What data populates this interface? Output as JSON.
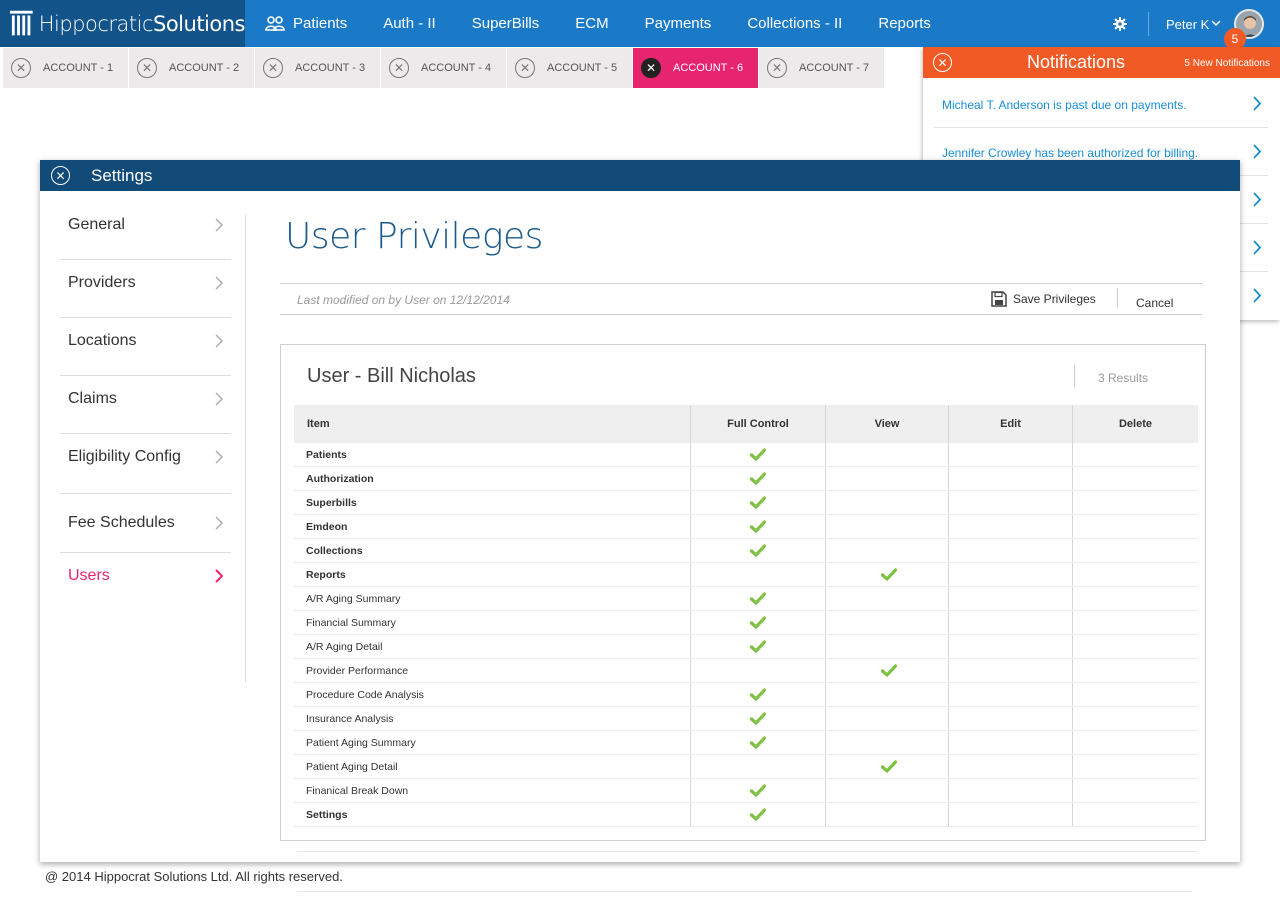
{
  "app": {
    "logo_light": "Hippocratic",
    "logo_bold": "Solutions"
  },
  "nav": {
    "items": [
      {
        "label": "Patients",
        "icon": "people-icon"
      },
      {
        "label": "Auth - II"
      },
      {
        "label": "SuperBills"
      },
      {
        "label": "ECM"
      },
      {
        "label": "Payments"
      },
      {
        "label": "Collections - II"
      },
      {
        "label": "Reports"
      }
    ],
    "user_name": "Peter K",
    "notification_count": "5"
  },
  "tabs": [
    {
      "label": "ACCOUNT - 1"
    },
    {
      "label": "ACCOUNT - 2"
    },
    {
      "label": "ACCOUNT - 3"
    },
    {
      "label": "ACCOUNT - 4"
    },
    {
      "label": "ACCOUNT - 5"
    },
    {
      "label": "ACCOUNT - 6",
      "active": true
    },
    {
      "label": "ACCOUNT - 7"
    }
  ],
  "notifications": {
    "title": "Notifications",
    "count_label": "5 New Notifications",
    "items": [
      {
        "text": "Micheal T. Anderson is past due on payments."
      },
      {
        "text": "Jennifer Crowley has been authorized for billing."
      },
      {
        "text": ""
      },
      {
        "text": ""
      },
      {
        "text": ""
      }
    ]
  },
  "settings": {
    "title": "Settings",
    "sidebar": [
      {
        "label": "General"
      },
      {
        "label": "Providers"
      },
      {
        "label": "Locations"
      },
      {
        "label": "Claims"
      },
      {
        "label": "Eligibility Config"
      },
      {
        "label": "Fee Schedules"
      },
      {
        "label": "Users",
        "active": true
      }
    ],
    "page_title": "User Privileges",
    "meta": "Last modified on by User on 12/12/2014",
    "save_label": "Save Privileges",
    "cancel_label": "Cancel",
    "panel_title": "User - Bill Nicholas",
    "results": "3 Results",
    "columns": [
      "Item",
      "Full Control",
      "View",
      "Edit",
      "Delete"
    ],
    "rows": [
      {
        "item": "Patients",
        "bold": true,
        "perm": "full"
      },
      {
        "item": "Authorization",
        "bold": true,
        "perm": "full"
      },
      {
        "item": "Superbills",
        "bold": true,
        "perm": "full"
      },
      {
        "item": "Emdeon",
        "bold": true,
        "perm": "full"
      },
      {
        "item": "Collections",
        "bold": true,
        "perm": "full"
      },
      {
        "item": "Reports",
        "bold": true,
        "perm": "view"
      },
      {
        "item": "A/R Aging Summary",
        "bold": false,
        "perm": "full"
      },
      {
        "item": "Financial Summary",
        "bold": false,
        "perm": "full"
      },
      {
        "item": "A/R Aging Detail",
        "bold": false,
        "perm": "full"
      },
      {
        "item": "Provider Performance",
        "bold": false,
        "perm": "view"
      },
      {
        "item": "Procedure Code Analysis",
        "bold": false,
        "perm": "full"
      },
      {
        "item": "Insurance Analysis",
        "bold": false,
        "perm": "full"
      },
      {
        "item": "Patient Aging Summary",
        "bold": false,
        "perm": "full"
      },
      {
        "item": "Patient Aging Detail",
        "bold": false,
        "perm": "view"
      },
      {
        "item": "Finanical Break Down",
        "bold": false,
        "perm": "full"
      },
      {
        "item": "Settings",
        "bold": true,
        "perm": "full"
      }
    ]
  },
  "footer": "@ 2014 Hippocrat Solutions Ltd. All rights reserved.",
  "colors": {
    "primary": "#1a7ac7",
    "dark": "#124a78",
    "accent": "#e6246f",
    "alert": "#f15a24",
    "check": "#7cc142"
  }
}
